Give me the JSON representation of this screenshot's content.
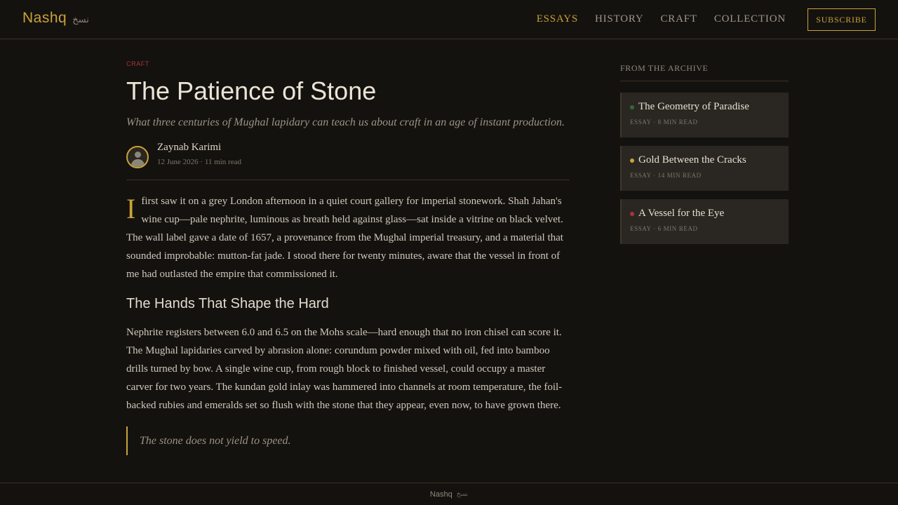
{
  "header": {
    "brand": "Nashq",
    "brand_arabic": "نسخ",
    "nav": [
      "ESSAYS",
      "HISTORY",
      "CRAFT",
      "COLLECTION"
    ],
    "active_nav": "ESSAYS",
    "subscribe": "SUBSCRIBE"
  },
  "article": {
    "kicker": "CRAFT",
    "title": "The Patience of Stone",
    "dek": "What three centuries of Mughal lapidary can teach us about craft in an age of instant production.",
    "author": "Zaynab Karimi",
    "meta": "12 June 2026 · 11 min read",
    "dropcap": "I",
    "para1": "first saw it on a grey London afternoon in a quiet court gallery for imperial stonework. Shah Jahan's wine cup—pale nephrite, luminous as breath held against glass—sat inside a vitrine on black velvet. The wall label gave a date of 1657, a provenance from the Mughal imperial treasury, and a material that sounded improbable: mutton-fat jade. I stood there for twenty minutes, aware that the vessel in front of me had outlasted the empire that commissioned it.",
    "heading": "The Hands That Shape the Hard",
    "para2": "Nephrite registers between 6.0 and 6.5 on the Mohs scale—hard enough that no iron chisel can score it. The Mughal lapidaries carved by abrasion alone: corundum powder mixed with oil, fed into bamboo drills turned by bow. A single wine cup, from rough block to finished vessel, could occupy a master carver for two years. The kundan gold inlay was hammered into channels at room temperature, the foil-backed rubies and emeralds set so flush with the stone that they appear, even now, to have grown there.",
    "quote": "The stone does not yield to speed."
  },
  "sidebar": {
    "title": "FROM THE ARCHIVE",
    "items": [
      {
        "title": "The Geometry of Paradise",
        "meta": "ESSAY · 8 MIN READ",
        "dot_color": "#2f6b3e"
      },
      {
        "title": "Gold Between the Cracks",
        "meta": "ESSAY · 14 MIN READ",
        "dot_color": "#c9a23a"
      },
      {
        "title": "A Vessel for the Eye",
        "meta": "ESSAY · 6 MIN READ",
        "dot_color": "#a8343d"
      }
    ]
  },
  "footer": {
    "brand": "Nashq",
    "brand_arabic": "نسخ"
  },
  "colors": {
    "accent": "#c9a23a",
    "background": "#14120f",
    "kicker": "#a8343d"
  }
}
